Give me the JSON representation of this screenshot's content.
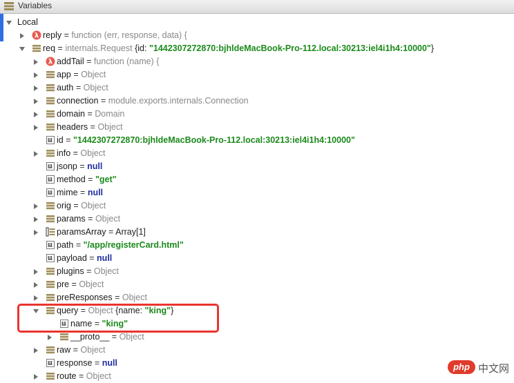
{
  "panel": {
    "title": "Variables"
  },
  "tree": [
    {
      "d": 0,
      "arrow": "down",
      "icon": "",
      "name": "Local"
    },
    {
      "d": 1,
      "arrow": "right",
      "icon": "lambda",
      "name": "reply",
      "val": [
        {
          "c": "ty",
          "t": "function (err, response, data) {"
        }
      ]
    },
    {
      "d": 1,
      "arrow": "down",
      "icon": "object",
      "name": "req",
      "val": [
        {
          "c": "ty",
          "t": "internals.Request"
        },
        {
          "c": "plain",
          "t": " {id: "
        },
        {
          "c": "str",
          "t": "\"1442307272870:bjhldeMacBook-Pro-112.local:30213:iel4i1h4:10000\""
        },
        {
          "c": "plain",
          "t": "}"
        }
      ]
    },
    {
      "d": 2,
      "arrow": "right",
      "icon": "lambda",
      "name": "addTail",
      "val": [
        {
          "c": "ty",
          "t": "function (name) {"
        }
      ]
    },
    {
      "d": 2,
      "arrow": "right",
      "icon": "object",
      "name": "app",
      "val": [
        {
          "c": "ty",
          "t": "Object"
        }
      ]
    },
    {
      "d": 2,
      "arrow": "right",
      "icon": "object",
      "name": "auth",
      "val": [
        {
          "c": "ty",
          "t": "Object"
        }
      ]
    },
    {
      "d": 2,
      "arrow": "right",
      "icon": "object",
      "name": "connection",
      "val": [
        {
          "c": "ty",
          "t": "module.exports.internals.Connection"
        }
      ]
    },
    {
      "d": 2,
      "arrow": "right",
      "icon": "object",
      "name": "domain",
      "val": [
        {
          "c": "ty",
          "t": "Domain"
        }
      ]
    },
    {
      "d": 2,
      "arrow": "right",
      "icon": "object",
      "name": "headers",
      "val": [
        {
          "c": "ty",
          "t": "Object"
        }
      ]
    },
    {
      "d": 2,
      "arrow": "",
      "icon": "prim",
      "name": "id",
      "val": [
        {
          "c": "str",
          "t": "\"1442307272870:bjhldeMacBook-Pro-112.local:30213:iel4i1h4:10000\""
        }
      ]
    },
    {
      "d": 2,
      "arrow": "right",
      "icon": "object",
      "name": "info",
      "val": [
        {
          "c": "ty",
          "t": "Object"
        }
      ]
    },
    {
      "d": 2,
      "arrow": "",
      "icon": "prim",
      "name": "jsonp",
      "val": [
        {
          "c": "kw",
          "t": "null"
        }
      ]
    },
    {
      "d": 2,
      "arrow": "",
      "icon": "prim",
      "name": "method",
      "val": [
        {
          "c": "str",
          "t": "\"get\""
        }
      ]
    },
    {
      "d": 2,
      "arrow": "",
      "icon": "prim",
      "name": "mime",
      "val": [
        {
          "c": "kw",
          "t": "null"
        }
      ]
    },
    {
      "d": 2,
      "arrow": "right",
      "icon": "object",
      "name": "orig",
      "val": [
        {
          "c": "ty",
          "t": "Object"
        }
      ]
    },
    {
      "d": 2,
      "arrow": "right",
      "icon": "object",
      "name": "params",
      "val": [
        {
          "c": "ty",
          "t": "Object"
        }
      ]
    },
    {
      "d": 2,
      "arrow": "right",
      "icon": "array",
      "name": "paramsArray",
      "val": [
        {
          "c": "plain",
          "t": "Array[1]"
        }
      ]
    },
    {
      "d": 2,
      "arrow": "",
      "icon": "prim",
      "name": "path",
      "val": [
        {
          "c": "str",
          "t": "\"/app/registerCard.html\""
        }
      ]
    },
    {
      "d": 2,
      "arrow": "",
      "icon": "prim",
      "name": "payload",
      "val": [
        {
          "c": "kw",
          "t": "null"
        }
      ]
    },
    {
      "d": 2,
      "arrow": "right",
      "icon": "object",
      "name": "plugins",
      "val": [
        {
          "c": "ty",
          "t": "Object"
        }
      ]
    },
    {
      "d": 2,
      "arrow": "right",
      "icon": "object",
      "name": "pre",
      "val": [
        {
          "c": "ty",
          "t": "Object"
        }
      ]
    },
    {
      "d": 2,
      "arrow": "right",
      "icon": "object",
      "name": "preResponses",
      "val": [
        {
          "c": "ty",
          "t": "Object"
        }
      ]
    },
    {
      "d": 2,
      "arrow": "down",
      "icon": "object",
      "name": "query",
      "val": [
        {
          "c": "ty",
          "t": "Object"
        },
        {
          "c": "plain",
          "t": " {name: "
        },
        {
          "c": "str",
          "t": "\"king\""
        },
        {
          "c": "plain",
          "t": "}"
        }
      ]
    },
    {
      "d": 3,
      "arrow": "",
      "icon": "prim",
      "name": "name",
      "val": [
        {
          "c": "str",
          "t": "\"king\""
        }
      ]
    },
    {
      "d": 3,
      "arrow": "right",
      "icon": "object",
      "name": "__proto__",
      "val": [
        {
          "c": "ty",
          "t": "Object"
        }
      ]
    },
    {
      "d": 2,
      "arrow": "right",
      "icon": "object",
      "name": "raw",
      "val": [
        {
          "c": "ty",
          "t": "Object"
        }
      ]
    },
    {
      "d": 2,
      "arrow": "",
      "icon": "prim",
      "name": "response",
      "val": [
        {
          "c": "kw",
          "t": "null"
        }
      ]
    },
    {
      "d": 2,
      "arrow": "right",
      "icon": "object",
      "name": "route",
      "val": [
        {
          "c": "ty",
          "t": "Object"
        }
      ]
    }
  ],
  "watermark": {
    "logo": "php",
    "text": "中文网"
  },
  "colors": {
    "highlight": "#e8342e",
    "string": "#1b8a1b",
    "keyword": "#1f2f9f",
    "type": "#888888"
  }
}
